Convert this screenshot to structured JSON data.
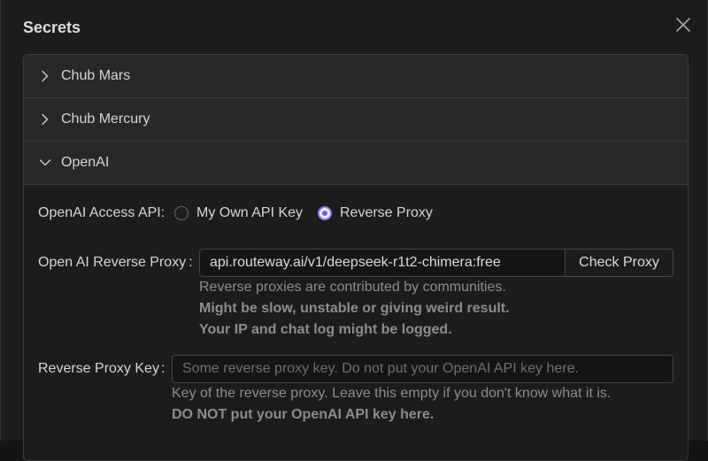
{
  "modal": {
    "title": "Secrets",
    "close_icon": "close-icon"
  },
  "accordion": {
    "sections": [
      {
        "label": "Chub Mars",
        "expanded": false
      },
      {
        "label": "Chub Mercury",
        "expanded": false
      },
      {
        "label": "OpenAI",
        "expanded": true
      }
    ]
  },
  "openai": {
    "access_api": {
      "label": "OpenAI Access API",
      "options": [
        {
          "label": "My Own API Key",
          "selected": false
        },
        {
          "label": "Reverse Proxy",
          "selected": true
        }
      ]
    },
    "reverse_proxy": {
      "label": "Open AI Reverse Proxy",
      "value": "api.routeway.ai/v1/deepseek-r1t2-chimera:free",
      "check_button": "Check Proxy",
      "hint_1": "Reverse proxies are contributed by communities.",
      "hint_2": "Might be slow, unstable or giving weird result.",
      "hint_3": "Your IP and chat log might be logged."
    },
    "proxy_key": {
      "label": "Reverse Proxy Key",
      "value": "",
      "placeholder": "Some reverse proxy key. Do not put your OpenAI API key here.",
      "hint_1": "Key of the reverse proxy. Leave this empty if you don't know what it is.",
      "hint_2": "DO NOT put your OpenAI API key here."
    },
    "colon": ":"
  },
  "colors": {
    "accent": "#6f5ee8",
    "background": "#1c1c1c",
    "header_background": "#282828"
  }
}
